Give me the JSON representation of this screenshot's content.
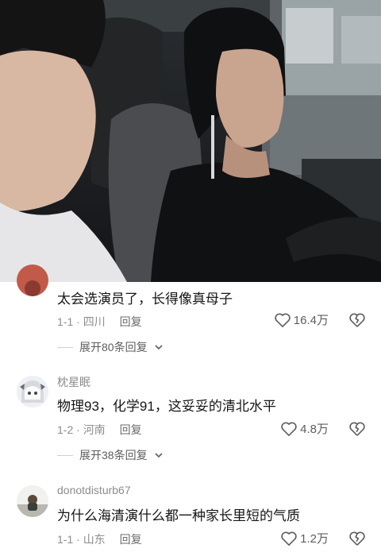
{
  "comments": [
    {
      "username": "",
      "text": "太会选演员了，长得像真母子",
      "meta_time": "1-1",
      "meta_location": "四川",
      "reply_label": "回复",
      "likes": "16.4万",
      "expand_label": "展开80条回复"
    },
    {
      "username": "枕星眠",
      "text": "物理93，化学91，这妥妥的清北水平",
      "meta_time": "1-2",
      "meta_location": "河南",
      "reply_label": "回复",
      "likes": "4.8万",
      "expand_label": "展开38条回复"
    },
    {
      "username": "donotdisturb67",
      "text": "为什么海清演什么都一种家长里短的气质",
      "meta_time": "1-1",
      "meta_location": "山东",
      "reply_label": "回复",
      "likes": "1.2万"
    }
  ],
  "icons": {
    "like": "heart-outline-icon",
    "dislike": "broken-heart-icon",
    "expand": "chevron-down-icon"
  },
  "colors": {
    "comment_text": "#161616",
    "meta_text": "#8d8d8d",
    "username_text": "#8c8c8c"
  }
}
